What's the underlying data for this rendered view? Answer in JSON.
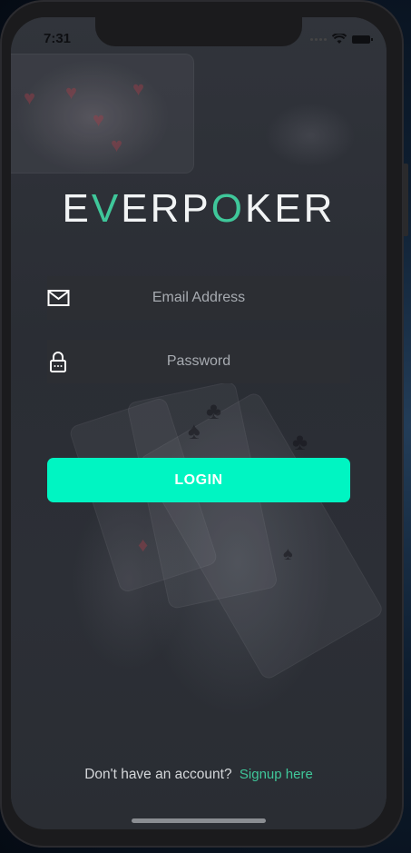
{
  "status_bar": {
    "time": "7:31"
  },
  "logo": {
    "part1": "E",
    "accent1": "V",
    "part2": "ERP",
    "accent2": "O",
    "part3": "KER"
  },
  "email": {
    "placeholder": "Email Address",
    "icon": "envelope-icon"
  },
  "password": {
    "placeholder": "Password",
    "icon": "lock-icon"
  },
  "login_button": {
    "label": "LOGIN"
  },
  "signup": {
    "question": "Don't have an account?",
    "link": "Signup here"
  },
  "colors": {
    "accent": "#3fc79a",
    "button": "#00f5c2",
    "field_bg": "#2c2e33"
  }
}
